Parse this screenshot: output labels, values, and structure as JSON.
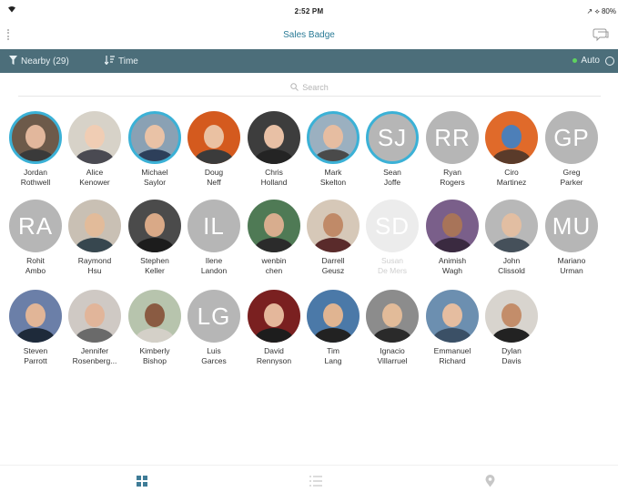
{
  "status": {
    "time": "2:52 PM",
    "right": "↗ ⟡ 80%"
  },
  "nav": {
    "title": "Sales Badge"
  },
  "filter": {
    "nearby_label": "Nearby (29)",
    "sort_label": "Time",
    "auto_label": "Auto"
  },
  "search": {
    "placeholder": "Search"
  },
  "colors": {
    "filter_bar": "#4c6e7a",
    "active_ring": "#3bb1d6",
    "title": "#2a7b96",
    "initials_bg": "#b6b6b6"
  },
  "people": [
    {
      "line1": "Jordan",
      "line2": "Rothwell",
      "initials": "",
      "active": true,
      "faded": false
    },
    {
      "line1": "Alice",
      "line2": "Kenower",
      "initials": "",
      "active": false,
      "faded": false
    },
    {
      "line1": "Michael",
      "line2": "Saylor",
      "initials": "",
      "active": true,
      "faded": false
    },
    {
      "line1": "Doug",
      "line2": "Neff",
      "initials": "",
      "active": false,
      "faded": false
    },
    {
      "line1": "Chris",
      "line2": "Holland",
      "initials": "",
      "active": false,
      "faded": false
    },
    {
      "line1": "Mark",
      "line2": "Skelton",
      "initials": "",
      "active": true,
      "faded": false
    },
    {
      "line1": "Sean",
      "line2": "Joffe",
      "initials": "SJ",
      "active": true,
      "faded": false
    },
    {
      "line1": "Ryan",
      "line2": "Rogers",
      "initials": "RR",
      "active": false,
      "faded": false
    },
    {
      "line1": "Ciro",
      "line2": "Martinez",
      "initials": "",
      "active": false,
      "faded": false
    },
    {
      "line1": "Greg",
      "line2": "Parker",
      "initials": "GP",
      "active": false,
      "faded": false
    },
    {
      "line1": "Rohit",
      "line2": "Ambo",
      "initials": "RA",
      "active": false,
      "faded": false
    },
    {
      "line1": "Raymond",
      "line2": "Hsu",
      "initials": "",
      "active": false,
      "faded": false
    },
    {
      "line1": "Stephen",
      "line2": "Keller",
      "initials": "",
      "active": false,
      "faded": false
    },
    {
      "line1": "Ilene",
      "line2": "Landon",
      "initials": "IL",
      "active": false,
      "faded": false
    },
    {
      "line1": "wenbin",
      "line2": "chen",
      "initials": "",
      "active": false,
      "faded": false
    },
    {
      "line1": "Darrell",
      "line2": "Geusz",
      "initials": "",
      "active": false,
      "faded": false
    },
    {
      "line1": "Susan",
      "line2": "De Mers",
      "initials": "SD",
      "active": false,
      "faded": true
    },
    {
      "line1": "Animish",
      "line2": "Wagh",
      "initials": "",
      "active": false,
      "faded": false
    },
    {
      "line1": "John",
      "line2": "Clissold",
      "initials": "",
      "active": false,
      "faded": false
    },
    {
      "line1": "Mariano",
      "line2": "Urman",
      "initials": "MU",
      "active": false,
      "faded": false
    },
    {
      "line1": "Steven",
      "line2": "Parrott",
      "initials": "",
      "active": false,
      "faded": false
    },
    {
      "line1": "Jennifer",
      "line2": "Rosenberg...",
      "initials": "",
      "active": false,
      "faded": false
    },
    {
      "line1": "Kimberly",
      "line2": "Bishop",
      "initials": "",
      "active": false,
      "faded": false
    },
    {
      "line1": "Luis",
      "line2": "Garces",
      "initials": "LG",
      "active": false,
      "faded": false
    },
    {
      "line1": "David",
      "line2": "Rennyson",
      "initials": "",
      "active": false,
      "faded": false
    },
    {
      "line1": "Tim",
      "line2": "Lang",
      "initials": "",
      "active": false,
      "faded": false
    },
    {
      "line1": "Ignacio",
      "line2": "Villarruel",
      "initials": "",
      "active": false,
      "faded": false
    },
    {
      "line1": "Emmanuel",
      "line2": "Richard",
      "initials": "",
      "active": false,
      "faded": false
    },
    {
      "line1": "Dylan",
      "line2": "Davis",
      "initials": "",
      "active": false,
      "faded": false
    }
  ],
  "tabs": [
    {
      "icon": "grid-icon",
      "selected": true
    },
    {
      "icon": "list-icon",
      "selected": false
    },
    {
      "icon": "map-pin-icon",
      "selected": false
    }
  ]
}
